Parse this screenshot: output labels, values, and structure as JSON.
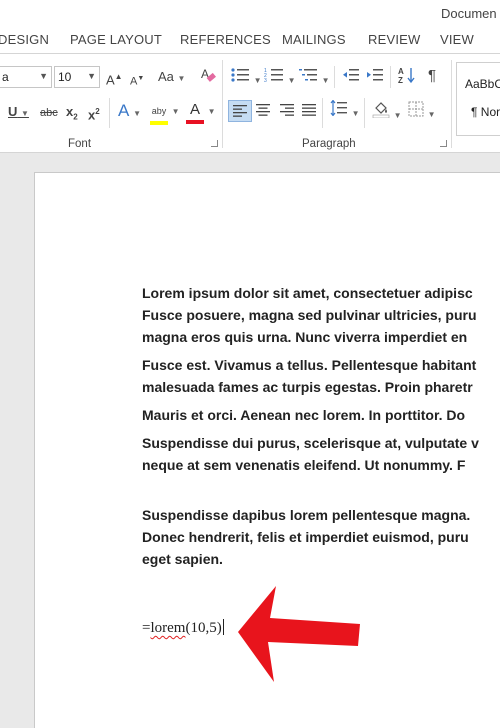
{
  "window": {
    "title": "Documen"
  },
  "tabs": [
    "DESIGN",
    "PAGE LAYOUT",
    "REFERENCES",
    "MAILINGS",
    "REVIEW",
    "VIEW"
  ],
  "ribbon": {
    "font": {
      "name_value": "a",
      "size_value": "10",
      "grow_label": "A",
      "shrink_label": "A",
      "case_label": "Aa",
      "underline_label": "U",
      "strike_label": "abc",
      "subscript_label": "x",
      "superscript_label": "x",
      "text_effects_label": "A",
      "highlight_label": "aby",
      "font_color_label": "A",
      "highlight_color": "#ffff00",
      "font_color": "#e81123",
      "group_label": "Font"
    },
    "paragraph": {
      "group_label": "Paragraph"
    },
    "styles": {
      "style1": "AaBbC",
      "style2": "¶ Nor"
    }
  },
  "document": {
    "paragraphs": [
      "Lorem ipsum dolor sit amet, consectetuer adipisc\nFusce posuere, magna sed pulvinar ultricies, puru\nmagna eros quis urna. Nunc viverra imperdiet en",
      "Fusce est. Vivamus a tellus. Pellentesque habitant\nmalesuada fames ac turpis egestas. Proin pharetr",
      "Mauris et orci. Aenean nec lorem. In porttitor. Do",
      "Suspendisse dui purus, scelerisque at, vulputate v\nneque at sem venenatis eleifend. Ut nonummy. F",
      "Suspendisse dapibus lorem pellentesque magna.\nDonec hendrerit, felis et imperdiet euismod, puru\neget sapien."
    ],
    "formula_prefix": "=",
    "formula_word": "lorem",
    "formula_args": "(10,5)"
  },
  "annotation": {
    "arrow_color": "#e8141c"
  }
}
